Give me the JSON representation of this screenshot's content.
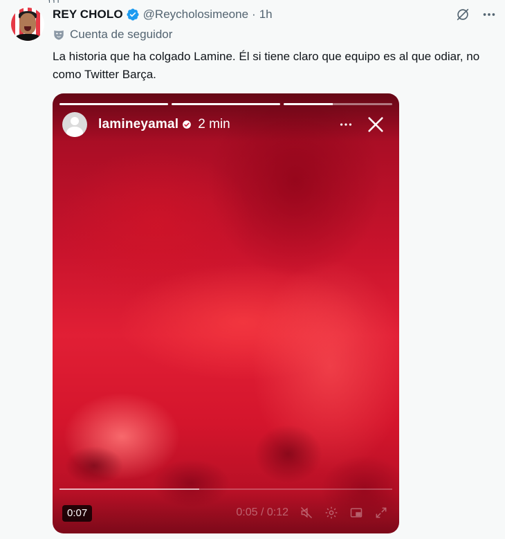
{
  "tweet": {
    "author_name": "REY CHOLO",
    "handle": "@Reycholosimeone",
    "separator": "·",
    "time": "1h",
    "context_label": "Cuenta de seguidor",
    "text": "La historia que ha colgado Lamine. Él si tiene claro que equipo es al que odiar, no como Twitter Barça.",
    "verified_color": "#1d9bf0"
  },
  "story": {
    "username": "lamineyamal",
    "time": "2 min",
    "segment_progress": [
      1.0,
      1.0,
      0.45
    ],
    "media_color": "#d4152c"
  },
  "video": {
    "duration_badge": "0:07",
    "elapsed_total": "0:05 / 0:12",
    "progress": 0.42
  },
  "icons": {
    "grok": "grok-icon",
    "more": "more-icon",
    "mask": "mask-icon",
    "close": "close-icon",
    "mute": "mute-icon",
    "settings": "gear-icon",
    "pip": "pip-icon",
    "fullscreen": "fullscreen-icon"
  }
}
